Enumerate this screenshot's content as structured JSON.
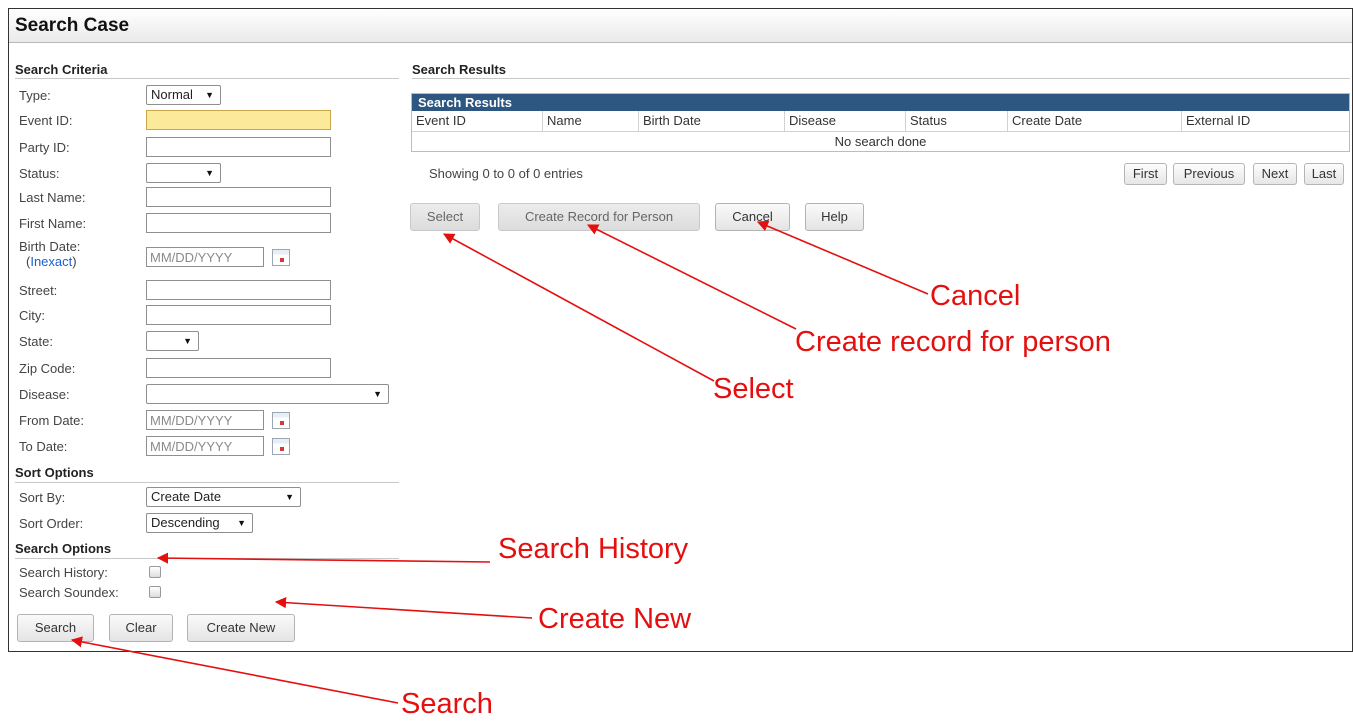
{
  "title": "Search Case",
  "criteria": {
    "heading": "Search Criteria",
    "type_label": "Type:",
    "type_value": "Normal",
    "event_id_label": "Event ID:",
    "party_id_label": "Party ID:",
    "status_label": "Status:",
    "last_name_label": "Last Name:",
    "first_name_label": "First Name:",
    "birth_date_label": "Birth Date:",
    "inexact_open": "(",
    "inexact_link": "Inexact",
    "inexact_close": ")",
    "date_placeholder": "MM/DD/YYYY",
    "street_label": "Street:",
    "city_label": "City:",
    "state_label": "State:",
    "zip_label": "Zip Code:",
    "disease_label": "Disease:",
    "from_date_label": "From Date:",
    "to_date_label": "To Date:"
  },
  "sort": {
    "heading": "Sort Options",
    "sort_by_label": "Sort By:",
    "sort_by_value": "Create Date",
    "sort_order_label": "Sort Order:",
    "sort_order_value": "Descending"
  },
  "options": {
    "heading": "Search Options",
    "history_label": "Search History:",
    "soundex_label": "Search Soundex:"
  },
  "left_buttons": {
    "search": "Search",
    "clear": "Clear",
    "create_new": "Create New"
  },
  "results": {
    "heading": "Search Results",
    "table_title": "Search Results",
    "columns": [
      "Event ID",
      "Name",
      "Birth Date",
      "Disease",
      "Status",
      "Create Date",
      "External ID"
    ],
    "empty_message": "No search done",
    "showing": "Showing 0 to 0 of 0 entries",
    "pager": {
      "first": "First",
      "previous": "Previous",
      "next": "Next",
      "last": "Last"
    },
    "buttons": {
      "select": "Select",
      "create_record": "Create Record for Person",
      "cancel": "Cancel",
      "help": "Help"
    }
  },
  "annotations": {
    "cancel": "Cancel",
    "create_record": "Create record for person",
    "select": "Select",
    "search_history": "Search History",
    "create_new": "Create New",
    "search": "Search"
  },
  "colors": {
    "annotation": "#e40f0f",
    "table_header": "#2d5680",
    "focus_field": "#fce99a",
    "link": "#1a5fd1"
  },
  "icons": {
    "calendar": "calendar-icon",
    "dropdown": "chevron-down-icon",
    "arrow": "arrow-icon"
  }
}
